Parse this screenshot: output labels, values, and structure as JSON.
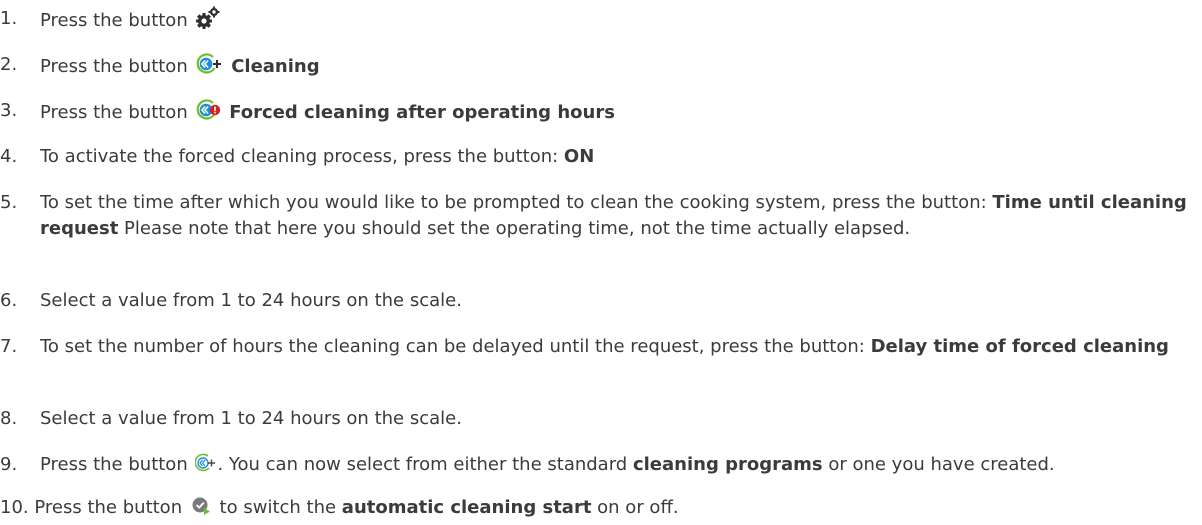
{
  "steps": [
    {
      "num": "1.",
      "pre": "Press the button ",
      "icon": "settings-gears-icon"
    },
    {
      "num": "2.",
      "pre": "Press the button ",
      "icon": "cleaning-icon",
      "bold": "Cleaning"
    },
    {
      "num": "3.",
      "pre": "Press the button ",
      "icon": "forced-cleaning-alert-icon",
      "bold": "Forced cleaning after operating hours"
    },
    {
      "num": "4.",
      "pre": "To activate the forced cleaning process, press the button: ",
      "bold": "ON"
    },
    {
      "num": "5.",
      "pre": "To set the time after which you would like to be prompted to clean the cooking system, press the button: ",
      "bold": "Time until cleaning request",
      "post": " Please note that here you should set the operating time, not the time actually elapsed."
    },
    {
      "num": "6.",
      "text": "Select a value from 1 to 24 hours on the scale."
    },
    {
      "num": "7.",
      "pre": "To set the number of hours the cleaning can be delayed until the request, press the button: ",
      "bold": "Delay time of forced cleaning"
    },
    {
      "num": "8.",
      "text": "Select a value from 1 to 24 hours on the scale."
    },
    {
      "num": "9.",
      "pre": "Press the button ",
      "icon": "cleaning-programs-icon",
      "mid": ". You can now select from either the standard ",
      "bold": "cleaning programs",
      "post": " or one you have created."
    },
    {
      "num": "10.",
      "pre": "Press the button ",
      "icon": "automatic-start-icon",
      "mid": " to switch the ",
      "bold": "automatic cleaning start",
      "post": " on or off."
    }
  ],
  "colors": {
    "text": "#3b3b3b",
    "icon_dark": "#2f2f2f",
    "icon_blue": "#1f8fd6",
    "icon_green": "#6fbe2e",
    "icon_red": "#d72020",
    "icon_gray": "#7a7a7a"
  }
}
